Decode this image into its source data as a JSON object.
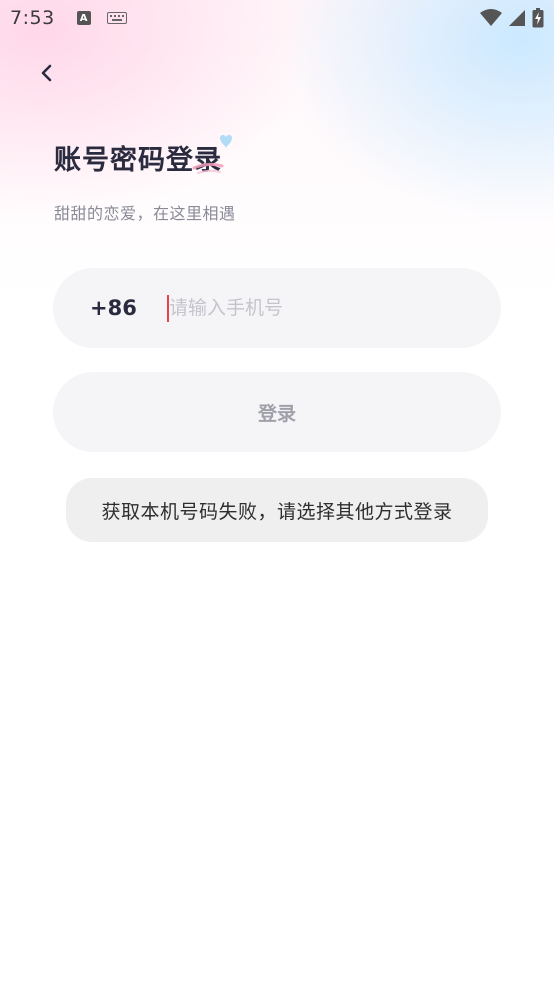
{
  "status_bar": {
    "time": "7:53",
    "icons": [
      "a-notification-icon",
      "keyboard-icon",
      "wifi-icon",
      "signal-icon",
      "battery-charging-icon"
    ]
  },
  "header": {
    "back_icon": "chevron-left-icon"
  },
  "page": {
    "title": "账号密码登录",
    "subtitle": "甜甜的恋爱，在这里相遇"
  },
  "phone": {
    "country_code": "+86",
    "placeholder": "请输入手机号",
    "value": ""
  },
  "login": {
    "label": "登录"
  },
  "toast": {
    "message": "获取本机号码失败，请选择其他方式登录"
  },
  "colors": {
    "title": "#2b2b40",
    "field_bg": "#f5f5f8",
    "cursor": "#e8424b",
    "toast_bg": "#efefef",
    "gradient_pink": "#ffd6e8",
    "gradient_blue": "#c8e8ff"
  }
}
